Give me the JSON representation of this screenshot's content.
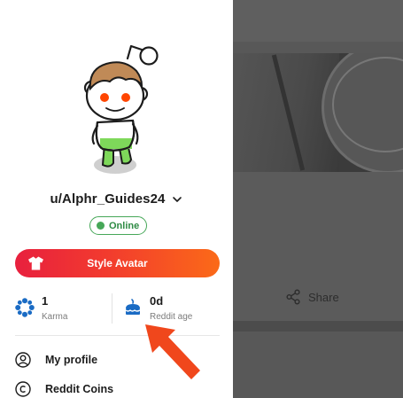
{
  "background": {
    "share_label": "Share"
  },
  "profile": {
    "username": "u/Alphr_Guides24",
    "status": "Online",
    "style_avatar_label": "Style Avatar"
  },
  "stats": {
    "karma": {
      "value": "1",
      "label": "Karma",
      "icon": "karma-flower-icon"
    },
    "age": {
      "value": "0d",
      "label": "Reddit age",
      "icon": "cake-icon"
    }
  },
  "menu": {
    "items": [
      {
        "label": "My profile",
        "icon": "user-circle-icon"
      },
      {
        "label": "Reddit Coins",
        "icon": "coin-icon"
      }
    ]
  },
  "colors": {
    "online_green": "#46a758",
    "button_gradient_start": "#e8203e",
    "button_gradient_end": "#fb6a18",
    "arrow": "#f0471c",
    "karma_blue": "#1a6bc4"
  }
}
